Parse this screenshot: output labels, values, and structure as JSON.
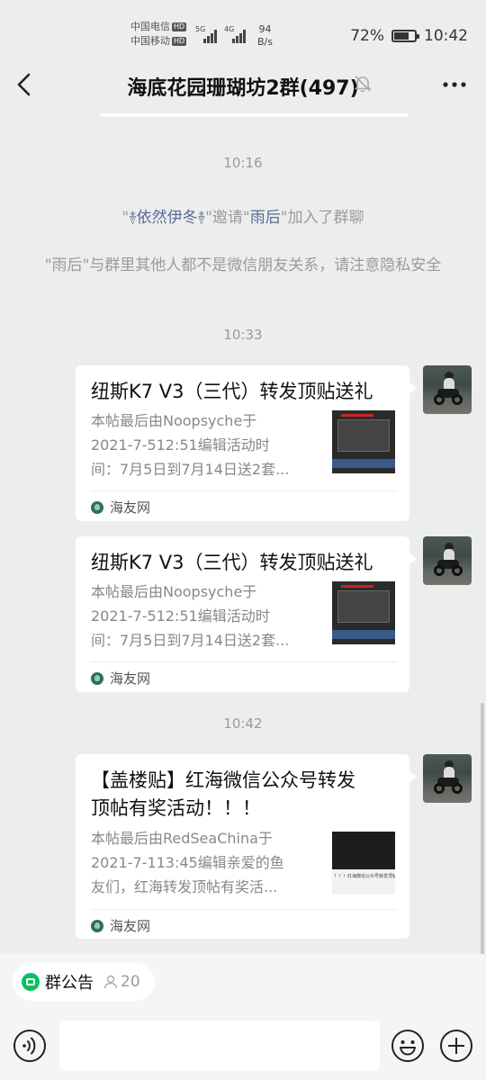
{
  "status_bar": {
    "carrier1": "中国电信",
    "carrier2": "中国移动",
    "hd": "HD",
    "net1": "5G",
    "net2": "4G",
    "speed_value": "94",
    "speed_unit": "B/s",
    "battery_percent": "72%",
    "battery_level": 0.72,
    "time": "10:42"
  },
  "header": {
    "title": "海底花园珊瑚坊2群(497)",
    "icons": [
      "back-arrow-icon",
      "mute-bell-icon",
      "more-icon"
    ]
  },
  "messages": {
    "time1": "10:16",
    "system1": {
      "quote_open": "\"",
      "inviter": "࿈依然伊冬࿈",
      "mid": "\"邀请\"",
      "invitee": "雨后",
      "end": "\"加入了群聊"
    },
    "system2": "\"雨后\"与群里其他人都不是微信朋友关系，请注意隐私安全",
    "time2": "10:33",
    "card1": {
      "title": "纽斯K7 V3（三代）转发顶贴送礼",
      "desc_line1": "本帖最后由Noopsyche于",
      "desc_line2": "2021-7-512:51编辑活动时",
      "desc_line3": "间：7月5日到7月14日送2套...",
      "source": "海友网"
    },
    "card2": {
      "title": "纽斯K7 V3（三代）转发顶贴送礼",
      "desc_line1": "本帖最后由Noopsyche于",
      "desc_line2": "2021-7-512:51编辑活动时",
      "desc_line3": "间：7月5日到7月14日送2套...",
      "source": "海友网"
    },
    "time3": "10:42",
    "card3": {
      "title_line1": "【盖楼贴】红海微信公众号转发",
      "title_line2": "顶帖有奖活动！！！",
      "desc_line1": "本帖最后由RedSeaChina于",
      "desc_line2": "2021-7-113:45编辑亲爱的鱼",
      "desc_line3": "友们，红海转发顶帖有奖活...",
      "thumb_caption": "！！！红海微信公众号转发顶帖",
      "source": "海友网"
    }
  },
  "notice": {
    "label": "群公告",
    "count": "20"
  },
  "input": {
    "placeholder": ""
  },
  "colors": {
    "background": "#ededed",
    "link_name": "#576b95",
    "accent_green": "#07c160"
  }
}
